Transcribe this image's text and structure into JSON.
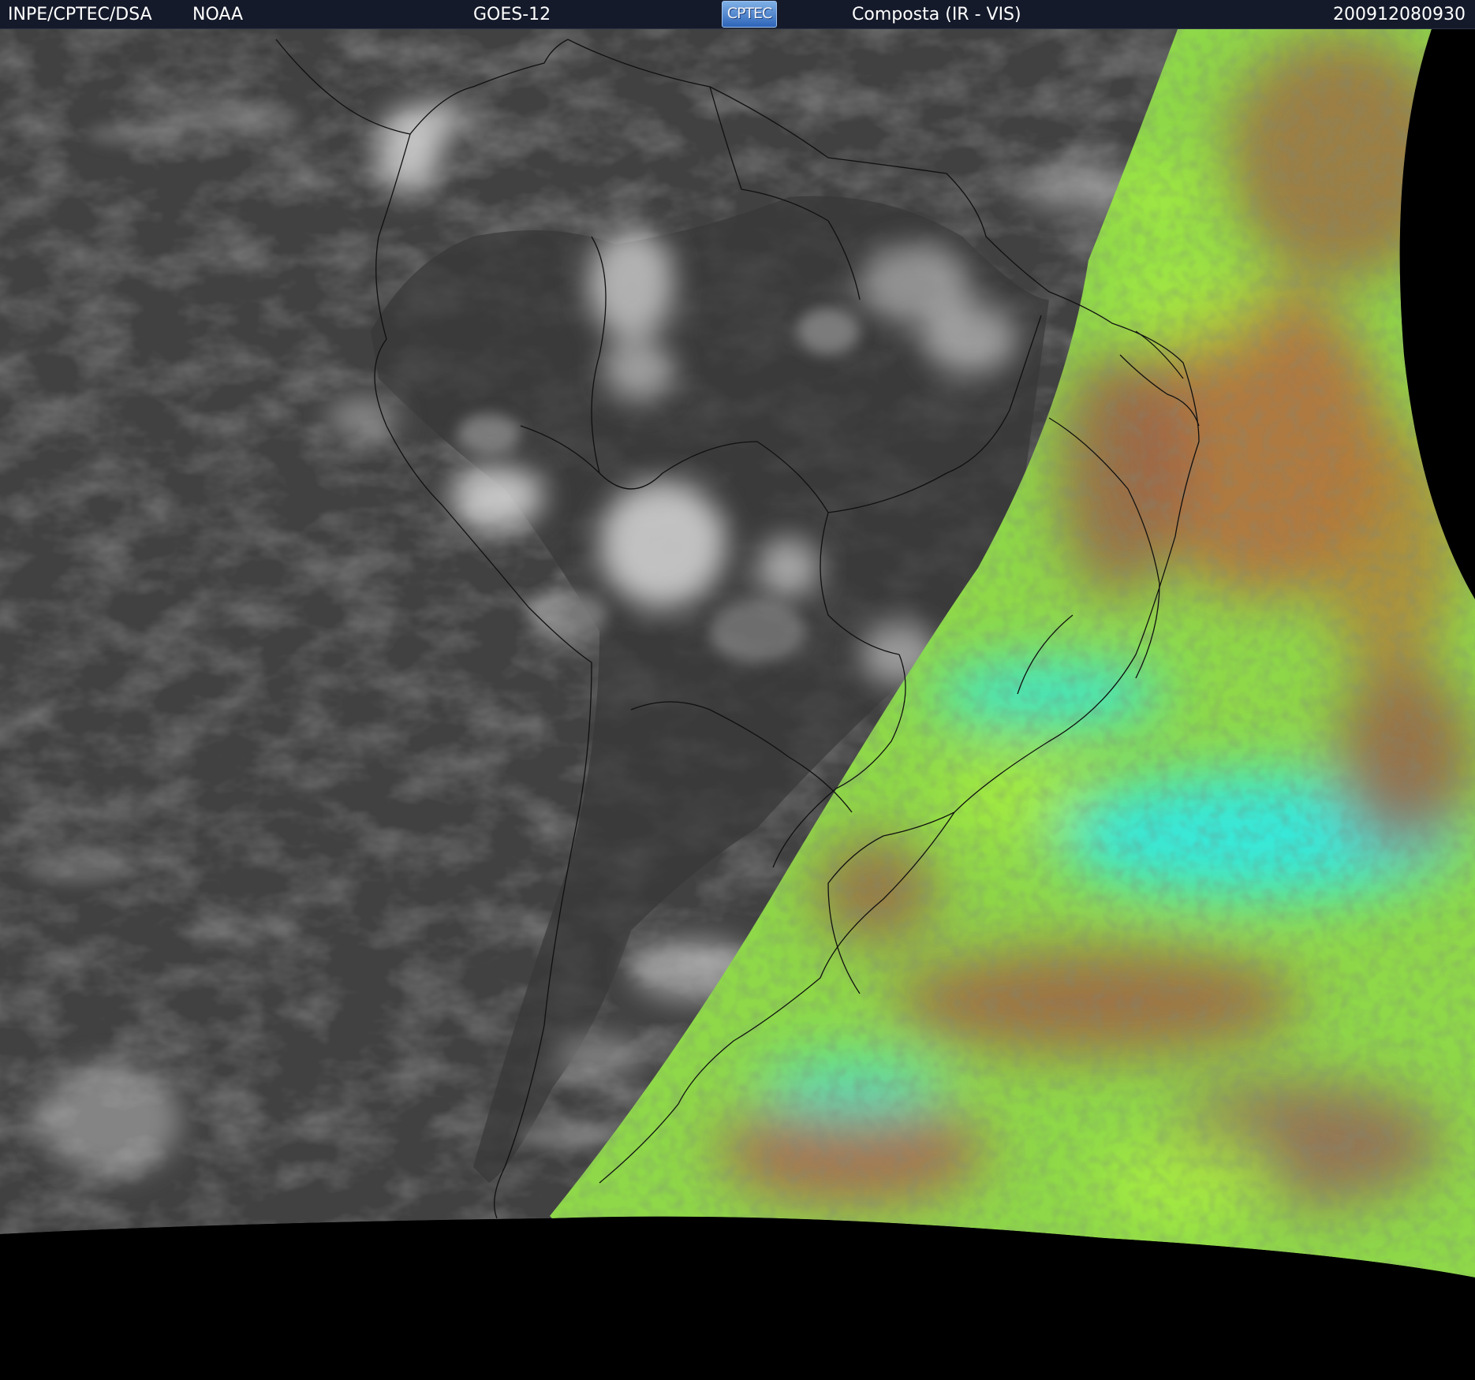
{
  "header": {
    "agency": "INPE/CPTEC/DSA",
    "source": "NOAA",
    "satellite": "GOES-12",
    "logo_text": "CPTEC",
    "product": "Composta (IR - VIS)",
    "timestamp": "200912080930"
  },
  "image": {
    "description_icon": "satellite-composite-image",
    "ir_tint": "#4a4a4a",
    "vis_colors": [
      "#a8f040",
      "#32e8e0",
      "#a05a45",
      "#c87a40"
    ],
    "background": "#000000"
  }
}
